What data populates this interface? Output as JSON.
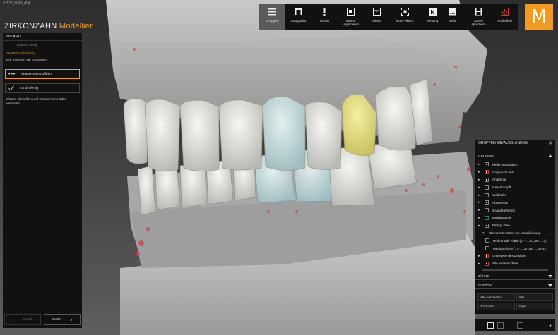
{
  "window": {
    "file_label": "v3172_8043_d94",
    "brand": "ZIRKONZAHN",
    "brand_suffix": ".Modellier",
    "logo_letter": "M"
  },
  "toolbar": [
    {
      "id": "gruppen",
      "label": "Gruppen",
      "icon": "menu-lines-icon",
      "active": true
    },
    {
      "id": "antagonist",
      "label": "Antagonist",
      "icon": "antagonist-icon"
    },
    {
      "id": "extras",
      "label": "Extras",
      "icon": "exclamation-icon"
    },
    {
      "id": "meshs",
      "label": "Meshs\nregistrieren",
      "icon": "mesh-register-icon"
    },
    {
      "id": "lineal",
      "label": "Lineal",
      "icon": "ruler-icon"
    },
    {
      "id": "scan",
      "label": "Scan-Aktion",
      "icon": "scan-frame-icon"
    },
    {
      "id": "nesting",
      "label": "Nesting",
      "icon": "nesting-icon"
    }
  ],
  "toolbar_right": [
    {
      "id": "mehr",
      "label": "Mehr",
      "icon": "more-dots-icon"
    },
    {
      "id": "speichern",
      "label": "Szene\nspeichern",
      "icon": "save-icon"
    },
    {
      "id": "schliessen",
      "label": "Schließen",
      "icon": "power-icon"
    }
  ],
  "wizard": {
    "header": "WIZARD",
    "mode": "Modus: Fertig",
    "done_text": "Der Wizard ist fertig.",
    "question": "Wie möchten sie fortfahren?",
    "master_menu": "Master Menü öffnen",
    "done_check": "ich bin fertig",
    "description": "Wizard schließen und in Expertenmodus wechseln",
    "back": "Zurück",
    "forward": "Weiter"
  },
  "groups_panel": {
    "title": "GRUPPEN EIN/AUSBLENDEN",
    "section": "GRUPPEN",
    "items": [
      {
        "label": "Kiefer-Scandaten",
        "exp": "▸",
        "box": "full",
        "level": 0
      },
      {
        "label": "Gingiva-Scans",
        "exp": "▸",
        "box": "part",
        "level": 0
      },
      {
        "label": "Anatomie",
        "exp": "▸",
        "box": "full",
        "level": 0
      },
      {
        "label": "Geschrumpft",
        "exp": "▸",
        "box": "empty",
        "level": 0
      },
      {
        "label": "Verbinder",
        "exp": "▸",
        "box": "empty",
        "level": 0
      },
      {
        "label": "Abutments",
        "exp": "▸",
        "box": "full",
        "level": 0
      },
      {
        "label": "Scanabutments",
        "exp": "▸",
        "box": "empty",
        "level": 0
      },
      {
        "label": "Implantatteile",
        "exp": "▸",
        "box": "green",
        "level": 0
      },
      {
        "label": "Fertige Teile",
        "exp": "▸",
        "box": "full",
        "level": 0
      },
      {
        "label": "Generierter Scan zur Visualisierung",
        "exp": "▾",
        "box": "none",
        "level": 1
      },
      {
        "label": "Horizontale Plane (17-.....27,36-.....3)",
        "exp": "",
        "box": "empty",
        "level": 2
      },
      {
        "label": "Median Plane (17-.....27,36-.....32-42",
        "exp": "",
        "box": "empty",
        "level": 2
      },
      {
        "label": "Unterseite des Designs",
        "exp": "▸",
        "box": "part",
        "level": 0
      },
      {
        "label": "Alle anderen Teile",
        "exp": "▸",
        "box": "part",
        "level": 0
      }
    ],
    "teeth_section": "ZÄHNE",
    "custom_section": "CUSTOM",
    "buttons": [
      "Alle verstecken",
      "Alle",
      "TouSmile",
      "Gips"
    ]
  },
  "colors": {
    "accent": "#f29a1d",
    "panel_bg": "#111111",
    "tooth_highlight": "#e6e07a",
    "tooth_blue": "#b8d4d8"
  }
}
